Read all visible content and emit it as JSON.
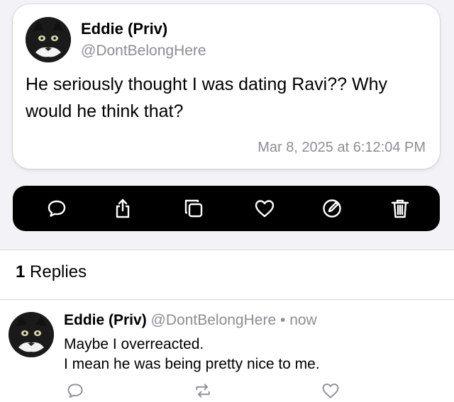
{
  "post": {
    "author_name": "Eddie (Priv)",
    "author_handle": "@DontBelongHere",
    "text": "He seriously thought I was dating Ravi?? Why\nwould he think that?",
    "timestamp": "Mar 8, 2025 at 6:12:04 PM"
  },
  "toolbar": {
    "icons": [
      "comment-icon",
      "share-icon",
      "copy-icon",
      "heart-icon",
      "edit-icon",
      "trash-icon"
    ],
    "background": "#000000",
    "icon_color": "#ffffff"
  },
  "replies_section": {
    "count": "1",
    "label": "Replies"
  },
  "reply": {
    "author_name": "Eddie (Priv)",
    "author_handle": "@DontBelongHere",
    "separator": "•",
    "time": "now",
    "text": "Maybe I overreacted.\nI mean he was being pretty nice to me.",
    "actions": [
      "comment-icon",
      "repost-icon",
      "heart-icon"
    ]
  },
  "colors": {
    "secondary_text": "#8e8e93",
    "page_background": "#f2f2f7"
  }
}
